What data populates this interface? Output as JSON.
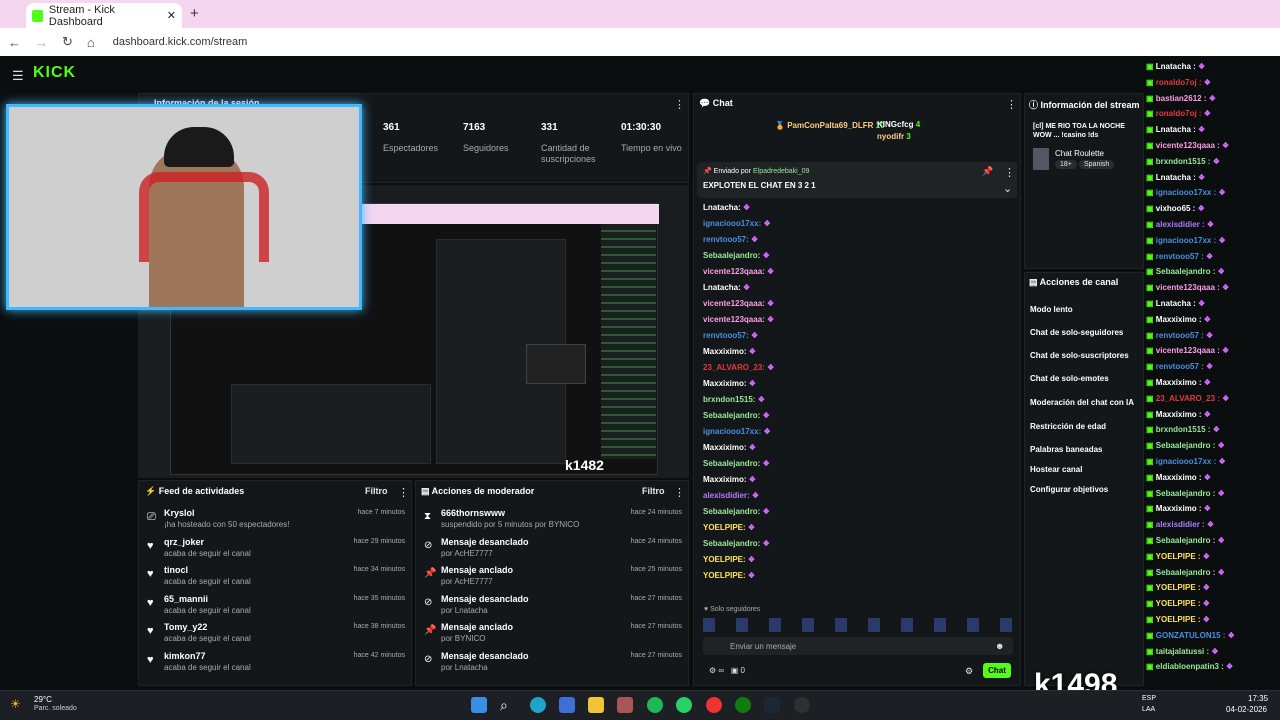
{
  "browser": {
    "tab_title": "Stream - Kick Dashboard",
    "url": "dashboard.kick.com/stream"
  },
  "kick": {
    "logo": "KICK"
  },
  "session": {
    "title": "Información de la sesión",
    "stats": [
      {
        "value": "361",
        "label": "Espectadores"
      },
      {
        "value": "7163",
        "label": "Seguidores"
      },
      {
        "value": "331",
        "label": "Cantidad de suscripciones"
      },
      {
        "value": "01:30:30",
        "label": "Tiempo en vivo"
      }
    ]
  },
  "activity": {
    "title": "Feed de actividades",
    "filter": "Filtro",
    "items": [
      {
        "user": "Kryslol",
        "desc": "¡ha hosteado con 50 espectadores!",
        "time": "hace 7 minutos",
        "icon": "host-icon"
      },
      {
        "user": "qrz_joker",
        "desc": "acaba de seguir el canal",
        "time": "hace 29 minutos",
        "icon": "heart-icon"
      },
      {
        "user": "tinocl",
        "desc": "acaba de seguir el canal",
        "time": "hace 34 minutos",
        "icon": "heart-icon"
      },
      {
        "user": "65_mannii",
        "desc": "acaba de seguir el canal",
        "time": "hace 35 minutos",
        "icon": "heart-icon"
      },
      {
        "user": "Tomy_y22",
        "desc": "acaba de seguir el canal",
        "time": "hace 38 minutos",
        "icon": "heart-icon"
      },
      {
        "user": "kimkon77",
        "desc": "acaba de seguir el canal",
        "time": "hace 42 minutos",
        "icon": "heart-icon"
      }
    ]
  },
  "modactions": {
    "title": "Acciones de moderador",
    "filter": "Filtro",
    "items": [
      {
        "title": "666thornswww",
        "desc": "suspendido por 5 minutos por BYNICO",
        "time": "hace 24 minutos",
        "icon": "timer-icon"
      },
      {
        "title": "Mensaje desanclado",
        "desc": "por AcHE7777",
        "time": "hace 24 minutos",
        "icon": "unpin-icon"
      },
      {
        "title": "Mensaje anclado",
        "desc": "por AcHE7777",
        "time": "hace 25 minutos",
        "icon": "pin-icon"
      },
      {
        "title": "Mensaje desanclado",
        "desc": "por Lnatacha",
        "time": "hace 27 minutos",
        "icon": "unpin-icon"
      },
      {
        "title": "Mensaje anclado",
        "desc": "por BYNICO",
        "time": "hace 27 minutos",
        "icon": "pin-icon"
      },
      {
        "title": "Mensaje desanclado",
        "desc": "por Lnatacha",
        "time": "hace 27 minutos",
        "icon": "unpin-icon"
      }
    ]
  },
  "chat": {
    "title": "Chat",
    "top_gifters": [
      {
        "name": "PamConPalta69_DLFR",
        "count": "10"
      },
      {
        "name": "KINGcfcg",
        "count": "4"
      },
      {
        "name": "nyodifr",
        "count": "3"
      }
    ],
    "pinned_by_label": "Enviado por",
    "pinned_by": "Elpadredebaki_09",
    "pinned_msg": "EXPLOTEN EL CHAT EN 3 2 1",
    "messages": [
      {
        "user": "Lnatacha:",
        "color": "#ffffff"
      },
      {
        "user": "ignaciooo17xx:",
        "color": "#4a90e2"
      },
      {
        "user": "renvtooo57:",
        "color": "#4a90e2"
      },
      {
        "user": "Sebaalejandro:",
        "color": "#9be89b"
      },
      {
        "user": "vicente123qaaa:",
        "color": "#ff9ee7"
      },
      {
        "user": "Lnatacha:",
        "color": "#ffffff"
      },
      {
        "user": "vicente123qaaa:",
        "color": "#ff9ee7"
      },
      {
        "user": "vicente123qaaa:",
        "color": "#ff9ee7"
      },
      {
        "user": "renvtooo57:",
        "color": "#4a90e2"
      },
      {
        "user": "Maxxiximo:",
        "color": "#ffffff"
      },
      {
        "user": "23_ALVARO_23:",
        "color": "#e23b3b"
      },
      {
        "user": "Maxxiximo:",
        "color": "#ffffff"
      },
      {
        "user": "brxndon1515:",
        "color": "#9be89b"
      },
      {
        "user": "Sebaalejandro:",
        "color": "#9be89b"
      },
      {
        "user": "ignaciooo17xx:",
        "color": "#4a90e2"
      },
      {
        "user": "Maxxiximo:",
        "color": "#ffffff"
      },
      {
        "user": "Sebaalejandro:",
        "color": "#9be89b"
      },
      {
        "user": "Maxxiximo:",
        "color": "#ffffff"
      },
      {
        "user": "alexisdidier:",
        "color": "#b07cff"
      },
      {
        "user": "Sebaalejandro:",
        "color": "#9be89b"
      },
      {
        "user": "YOELPIPE:",
        "color": "#ffe55c"
      },
      {
        "user": "Sebaalejandro:",
        "color": "#9be89b"
      },
      {
        "user": "YOELPIPE:",
        "color": "#ffe55c"
      },
      {
        "user": "YOELPIPE:",
        "color": "#ffe55c"
      }
    ],
    "followers_only": "Solo seguidores",
    "placeholder": "Enviar un mensaje",
    "send": "Chat",
    "count": "0"
  },
  "stream_info": {
    "title": "Información del stream",
    "stream_title": "[cl] ME RIO TOA LA NOCHE WOW ... !casino !ds",
    "category": "Chat Roulette",
    "tags": [
      "18+",
      "Spanish"
    ]
  },
  "channel_actions": {
    "title": "Acciones de canal",
    "items": [
      "Modo lento",
      "Chat de solo-seguidores",
      "Chat de solo-suscriptores",
      "Chat de solo-emotes",
      "Moderación del chat con IA",
      "Restricción de edad",
      "Palabras baneadas",
      "Hostear canal",
      "Configurar objetivos"
    ]
  },
  "overlay_chat": [
    {
      "user": "Lnatacha :",
      "color": "#ffffff"
    },
    {
      "user": "ronaldo7oj :",
      "color": "#e23b3b"
    },
    {
      "user": "bastian2612 :",
      "color": "#ff9ee7"
    },
    {
      "user": "ronaldo7oj :",
      "color": "#e23b3b"
    },
    {
      "user": "Lnatacha :",
      "color": "#ffffff"
    },
    {
      "user": "vicente123qaaa :",
      "color": "#ff9ee7"
    },
    {
      "user": "brxndon1515 :",
      "color": "#9be89b"
    },
    {
      "user": "Lnatacha :",
      "color": "#ffffff"
    },
    {
      "user": "ignaciooo17xx :",
      "color": "#4a90e2"
    },
    {
      "user": "vixhoo65 :",
      "color": "#ffffff"
    },
    {
      "user": "alexisdidier :",
      "color": "#b07cff"
    },
    {
      "user": "ignaciooo17xx :",
      "color": "#4a90e2"
    },
    {
      "user": "renvtooo57 :",
      "color": "#4a90e2"
    },
    {
      "user": "Sebaalejandro :",
      "color": "#9be89b"
    },
    {
      "user": "vicente123qaaa :",
      "color": "#ff9ee7"
    },
    {
      "user": "Lnatacha :",
      "color": "#ffffff"
    },
    {
      "user": "Maxxiximo :",
      "color": "#ffffff"
    },
    {
      "user": "renvtooo57 :",
      "color": "#4a90e2"
    },
    {
      "user": "vicente123qaaa :",
      "color": "#ff9ee7"
    },
    {
      "user": "renvtooo57 :",
      "color": "#4a90e2"
    },
    {
      "user": "Maxxiximo :",
      "color": "#ffffff"
    },
    {
      "user": "23_ALVARO_23 :",
      "color": "#e23b3b"
    },
    {
      "user": "Maxxiximo :",
      "color": "#ffffff"
    },
    {
      "user": "brxndon1515 :",
      "color": "#9be89b"
    },
    {
      "user": "Sebaalejandro :",
      "color": "#9be89b"
    },
    {
      "user": "ignaciooo17xx :",
      "color": "#4a90e2"
    },
    {
      "user": "Maxxiximo :",
      "color": "#ffffff"
    },
    {
      "user": "Sebaalejandro :",
      "color": "#9be89b"
    },
    {
      "user": "Maxxiximo :",
      "color": "#ffffff"
    },
    {
      "user": "alexisdidier :",
      "color": "#b07cff"
    },
    {
      "user": "Sebaalejandro :",
      "color": "#9be89b"
    },
    {
      "user": "YOELPIPE :",
      "color": "#ffe55c"
    },
    {
      "user": "Sebaalejandro :",
      "color": "#9be89b"
    },
    {
      "user": "YOELPIPE :",
      "color": "#ffe55c"
    },
    {
      "user": "YOELPIPE :",
      "color": "#ffe55c"
    },
    {
      "user": "YOELPIPE :",
      "color": "#ffe55c"
    },
    {
      "user": "GONZATULON15 :",
      "color": "#4a90e2"
    },
    {
      "user": "taitajalatussi :",
      "color": "#9be89b"
    },
    {
      "user": "eldiabloenpatin3 :",
      "color": "#9be89b"
    }
  ],
  "overlay_alert": "k1498",
  "preview_alert": "k1482",
  "weather": {
    "temp": "29°C",
    "desc": "Parc. soleado"
  },
  "clock": {
    "time": "17:35",
    "date": "04-02-2026",
    "lang": "ESP",
    "lang2": "LAA"
  }
}
